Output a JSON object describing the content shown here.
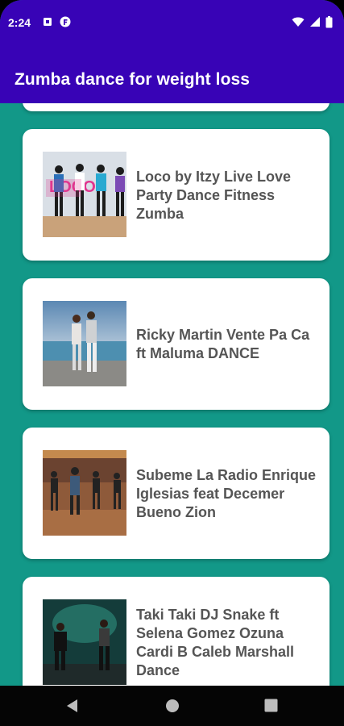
{
  "status": {
    "time": "2:24"
  },
  "app": {
    "title": "Zumba dance for weight loss"
  },
  "videos": [
    {
      "title": "Loco by Itzy Live Love Party Dance Fitness Zumba",
      "thumb_text": "LOCO"
    },
    {
      "title": "Ricky Martin Vente Pa Ca ft Maluma DANCE"
    },
    {
      "title": "Subeme La Radio Enrique Iglesias feat Decemer Bueno Zion"
    },
    {
      "title": "Taki Taki DJ Snake ft Selena Gomez Ozuna Cardi B Caleb Marshall Dance"
    }
  ],
  "colors": {
    "appbar": "#3803b6",
    "background": "#129888",
    "card": "#ffffff",
    "title_text": "#555555"
  }
}
